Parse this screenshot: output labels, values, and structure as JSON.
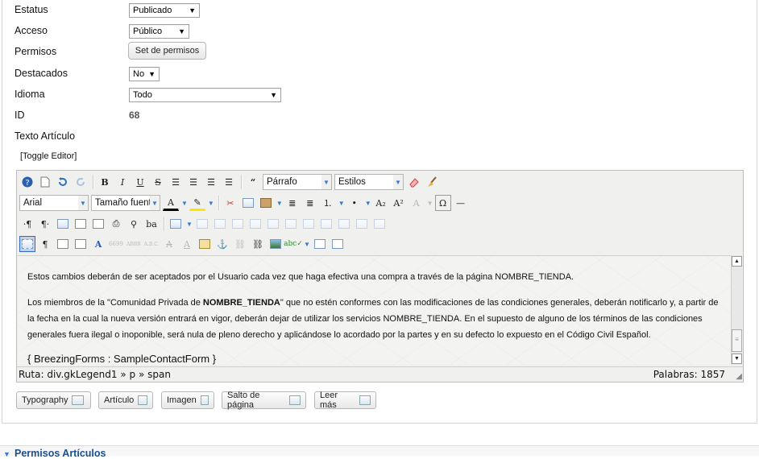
{
  "form": {
    "status": {
      "label": "Estatus",
      "value": "Publicado"
    },
    "access": {
      "label": "Acceso",
      "value": "Público"
    },
    "permissions": {
      "label": "Permisos",
      "button": "Set de permisos"
    },
    "featured": {
      "label": "Destacados",
      "value": "No"
    },
    "language": {
      "label": "Idioma",
      "value": "Todo"
    },
    "id": {
      "label": "ID",
      "value": "68"
    },
    "article_text": {
      "label": "Texto Artículo"
    },
    "toggle_editor": "[Toggle Editor]"
  },
  "editor": {
    "format_select": "Párrafo",
    "styles_select": "Estilos",
    "font_select": "Arial",
    "size_select": "Tamaño fuente",
    "content": {
      "p1": "Estos cambios deberán de ser aceptados por el Usuario cada vez que haga efectiva una compra a través de la página NOMBRE_TIENDA.",
      "p2_a": "Los miembros de la \"Comunidad Privada de ",
      "p2_bold": "NOMBRE_TIENDA",
      "p2_b": "\" que no estén conformes con las modificaciones de las condiciones generales, deberán notificarlo y, a partir de la fecha en la cual la nueva versión entrará en vigor, deberán dejar de utilizar los servicios NOMBRE_TIENDA. En el supuesto de alguno de los términos de las condiciones generales fuera ilegal o inoponible, será nula de pleno derecho y aplicándose lo acordado por la partes y en su defecto lo expuesto en el Código Civil Español.",
      "p3": "{ BreezingForms : SampleContactForm }"
    },
    "status_path": "Ruta: div.gkLegend1 » p » span",
    "status_words": "Palabras: 1857"
  },
  "extra_buttons": {
    "typography": "Typography",
    "article": "Artículo",
    "image": "Imagen",
    "pagebreak": "Salto de página",
    "readmore": "Leer más"
  },
  "permissions_section": "Permisos Artículos"
}
